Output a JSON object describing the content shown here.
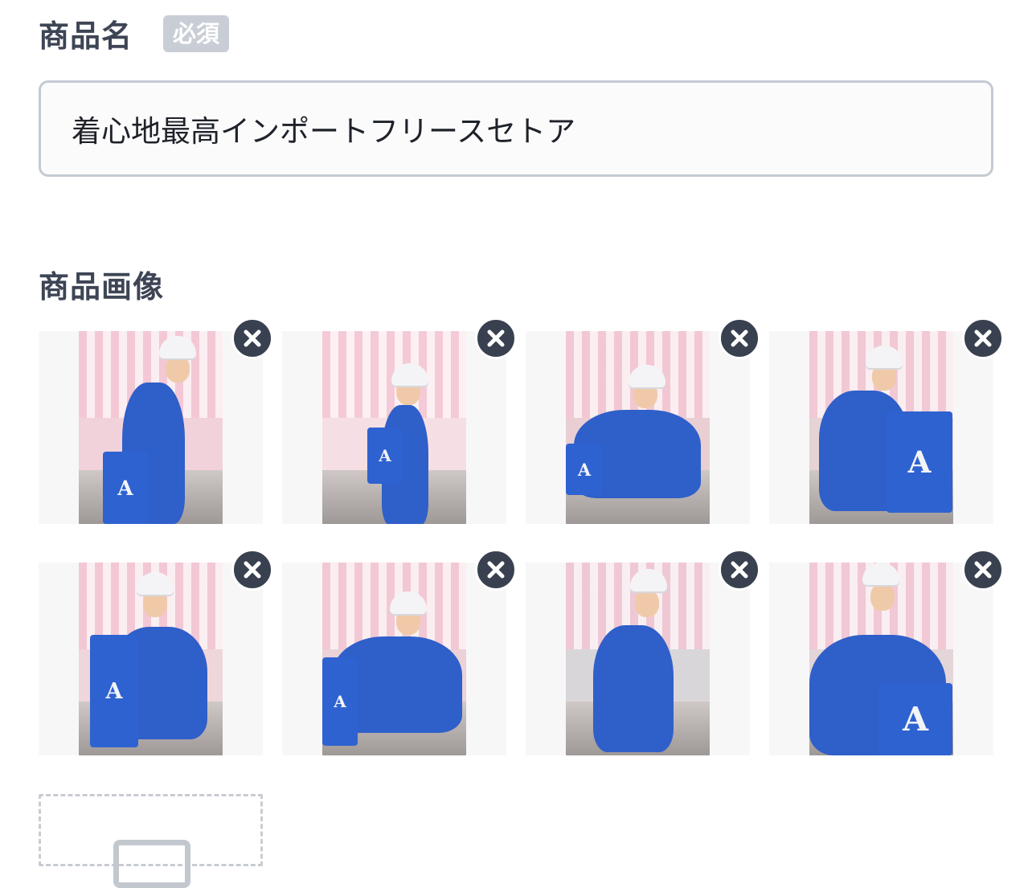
{
  "product_name": {
    "label": "商品名",
    "required_badge": "必須",
    "value": "着心地最高インポートフリースセトア"
  },
  "product_images": {
    "label": "商品画像",
    "images": [
      {
        "scene": "standing pink wall, tote bag",
        "hat_color": "#f4f4f6"
      },
      {
        "scene": "full body standing",
        "hat_color": "#f4f4f6"
      },
      {
        "scene": "sitting on floor",
        "hat_color": "#f4f4f6"
      },
      {
        "scene": "sitting hugging knees",
        "hat_color": "#f4f4f6"
      },
      {
        "scene": "crouching with bag",
        "hat_color": "#f4f4f6"
      },
      {
        "scene": "sitting cross-legged",
        "hat_color": "#f4f4f6"
      },
      {
        "scene": "leaning forward",
        "hat_color": "#f4f4f6"
      },
      {
        "scene": "selfie with bag",
        "hat_color": "#f4f4f6"
      }
    ],
    "remove_icon": "close-icon",
    "add_icon": "image-add-icon"
  },
  "colors": {
    "accent_dark": "#394150",
    "jacket_blue": "#2f5fc9",
    "badge_gray": "#c9ced6"
  }
}
